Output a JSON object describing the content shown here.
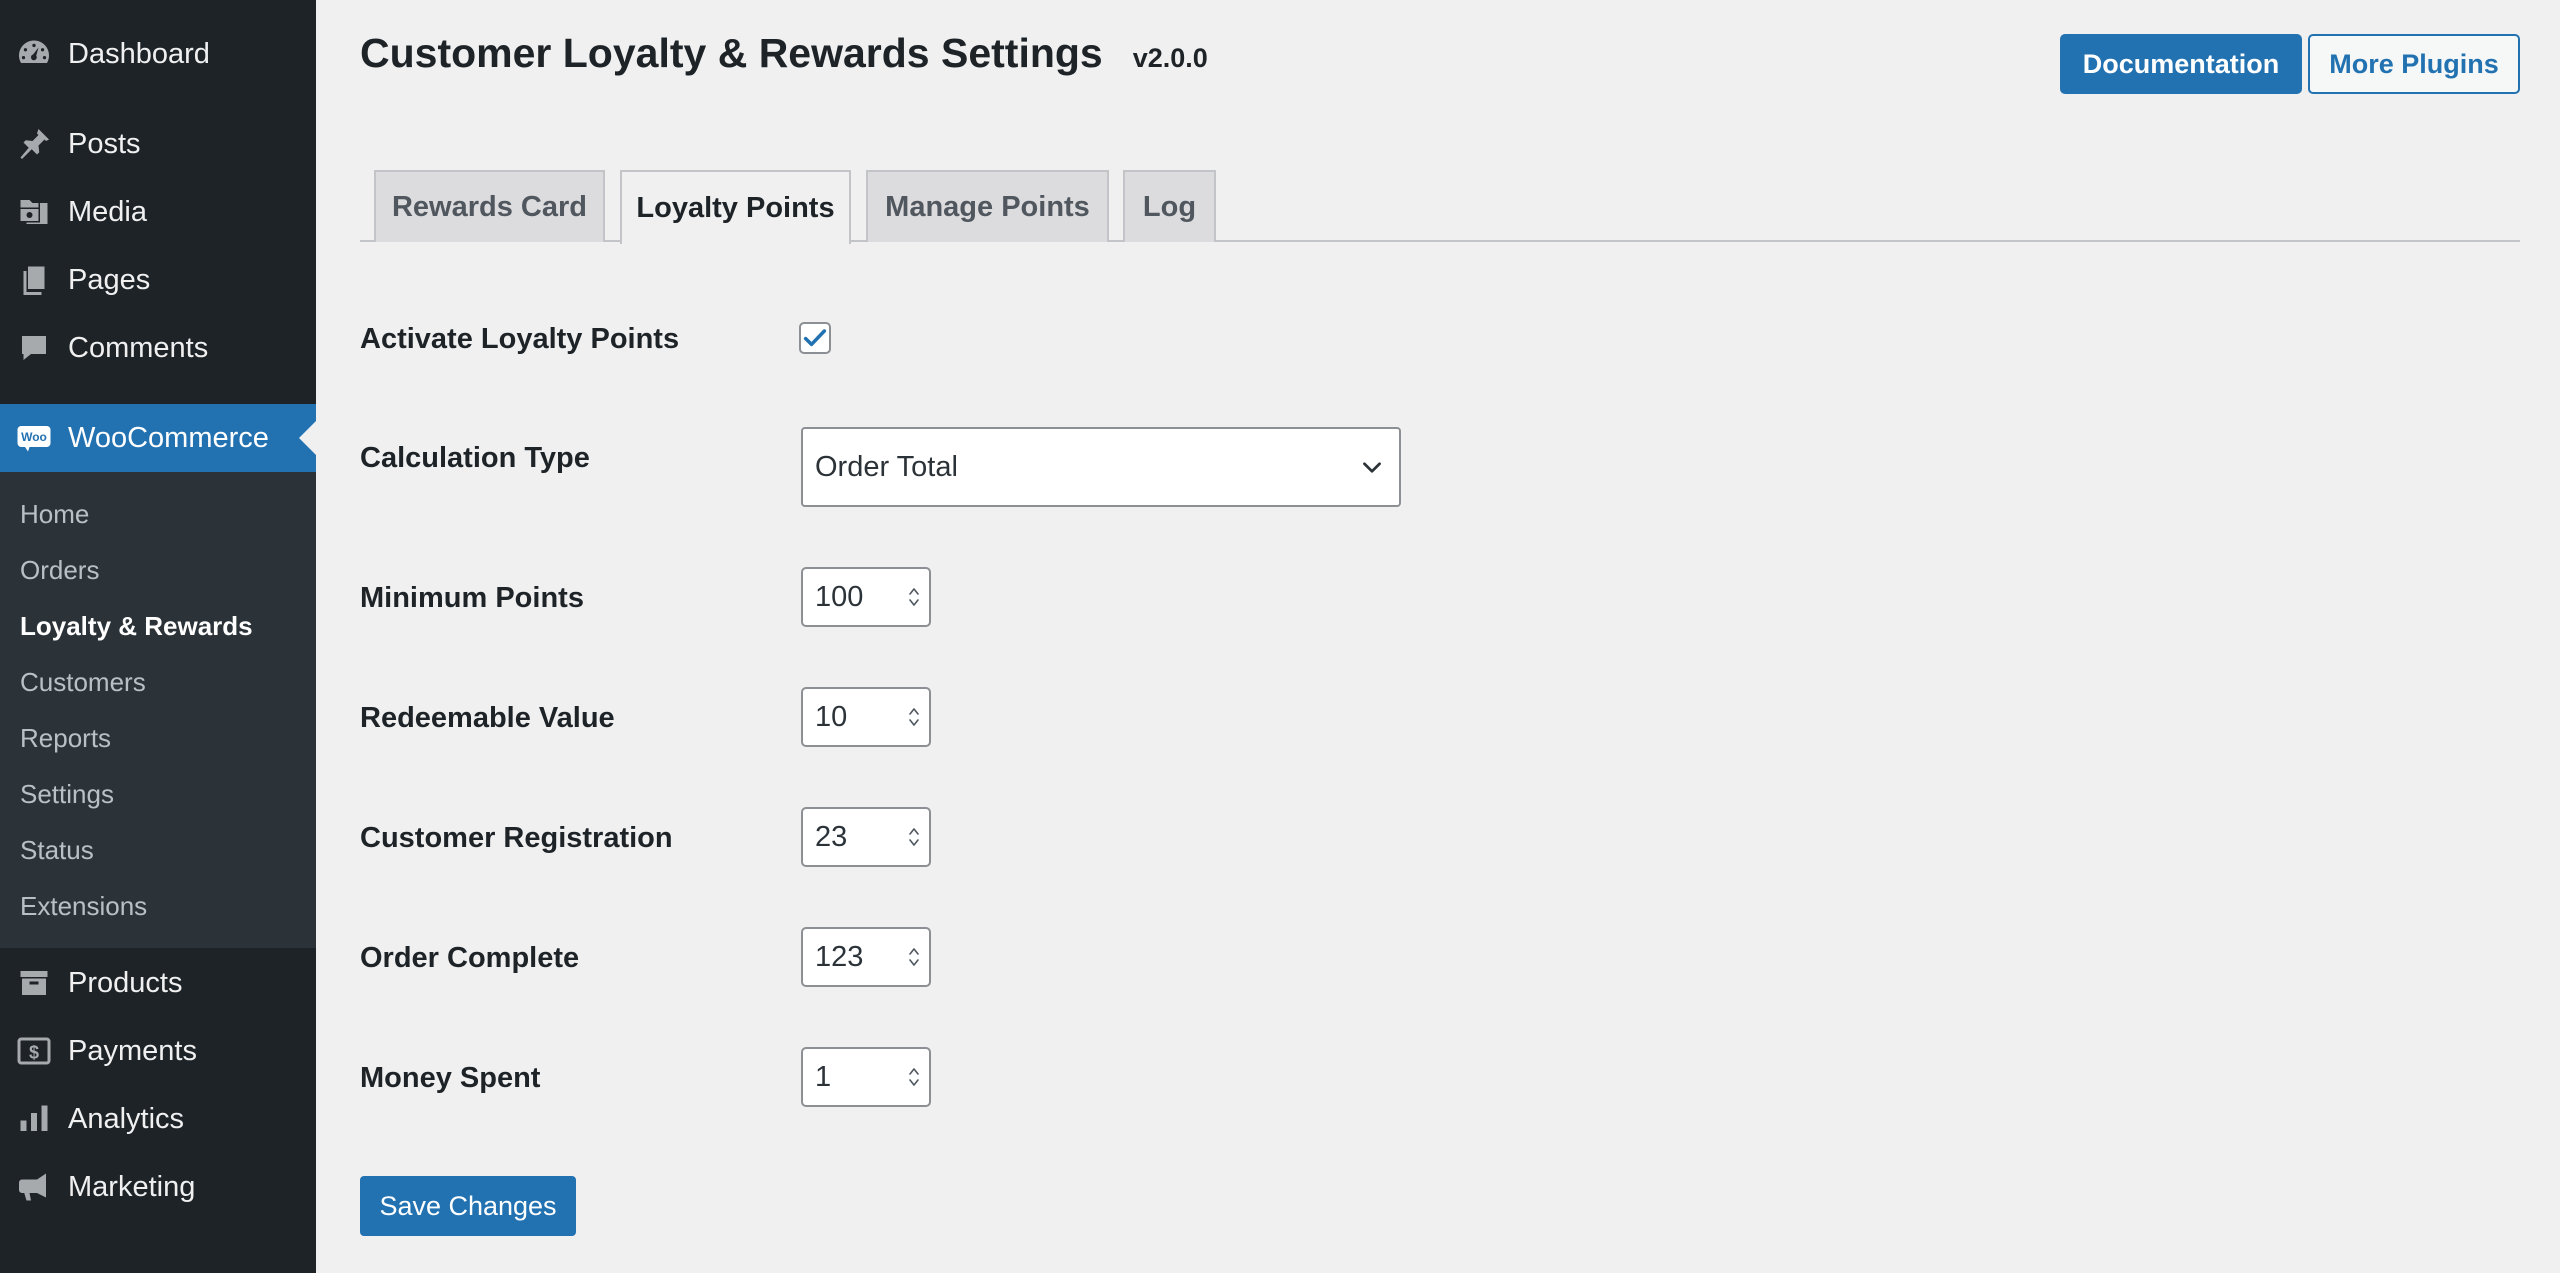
{
  "sidebar": {
    "menu": [
      {
        "label": "Dashboard",
        "icon": "dashboard-icon"
      },
      {
        "label": "Posts",
        "icon": "pushpin-icon"
      },
      {
        "label": "Media",
        "icon": "media-icon"
      },
      {
        "label": "Pages",
        "icon": "pages-icon"
      },
      {
        "label": "Comments",
        "icon": "comment-icon"
      },
      {
        "label": "WooCommerce",
        "icon": "woocommerce-icon",
        "logo_text": "Woo"
      },
      {
        "label": "Products",
        "icon": "archive-icon"
      },
      {
        "label": "Payments",
        "icon": "payments-icon"
      },
      {
        "label": "Analytics",
        "icon": "bar-chart-icon"
      },
      {
        "label": "Marketing",
        "icon": "megaphone-icon"
      }
    ],
    "submenu": [
      {
        "label": "Home"
      },
      {
        "label": "Orders"
      },
      {
        "label": "Loyalty & Rewards"
      },
      {
        "label": "Customers"
      },
      {
        "label": "Reports"
      },
      {
        "label": "Settings"
      },
      {
        "label": "Status"
      },
      {
        "label": "Extensions"
      }
    ],
    "current_menu": "WooCommerce",
    "current_submenu": "Loyalty & Rewards"
  },
  "header": {
    "title": "Customer Loyalty & Rewards Settings",
    "version": "v2.0.0",
    "documentation_label": "Documentation",
    "more_plugins_label": "More Plugins"
  },
  "tabs": [
    {
      "label": "Rewards Card",
      "active": false
    },
    {
      "label": "Loyalty Points",
      "active": true
    },
    {
      "label": "Manage Points",
      "active": false
    },
    {
      "label": "Log",
      "active": false
    }
  ],
  "form": {
    "activate": {
      "label": "Activate Loyalty Points",
      "checked": true
    },
    "calculation_type": {
      "label": "Calculation Type",
      "value": "Order Total"
    },
    "minimum_points": {
      "label": "Minimum Points",
      "value": "100"
    },
    "redeemable_value": {
      "label": "Redeemable Value",
      "value": "10"
    },
    "customer_registration": {
      "label": "Customer Registration",
      "value": "23"
    },
    "order_complete": {
      "label": "Order Complete",
      "value": "123"
    },
    "money_spent": {
      "label": "Money Spent",
      "value": "1"
    },
    "save_label": "Save Changes"
  },
  "colors": {
    "sidebar_bg": "#1d2327",
    "submenu_bg": "#2c3338",
    "accent": "#2271b1",
    "page_bg": "#f0f0f1"
  }
}
